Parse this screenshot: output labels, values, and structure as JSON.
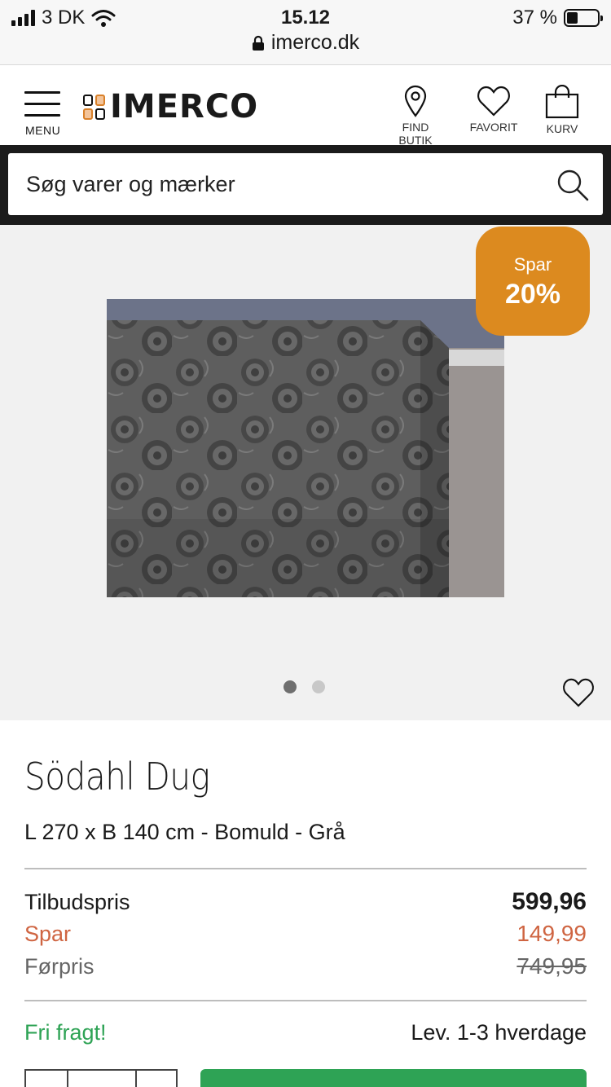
{
  "status_bar": {
    "carrier": "3 DK",
    "time": "15.12",
    "battery": "37 %",
    "battery_level": 0.37,
    "url": "imerco.dk"
  },
  "header": {
    "menu_label": "MENU",
    "logo_text": "IMERCO",
    "find_store_label": "FIND BUTIK",
    "favorite_label": "FAVORIT",
    "cart_label": "KURV"
  },
  "search": {
    "placeholder": "Søg varer og mærker"
  },
  "hero": {
    "badge_line1": "Spar",
    "badge_line2": "20%",
    "badge_color": "#dc8a1f",
    "image_count": 2,
    "active_image": 1
  },
  "product": {
    "title": "Södahl Dug",
    "subtitle": "L 270 x B 140 cm - Bomuld - Grå",
    "offer_label": "Tilbudspris",
    "offer_value": "599,96",
    "save_label": "Spar",
    "save_value": "149,99",
    "before_label": "Førpris",
    "before_value": "749,95",
    "shipping": "Fri fragt!",
    "delivery": "Lev. 1-3 hverdage"
  },
  "colors": {
    "accent_green": "#2ea355",
    "save_red": "#cf6542",
    "search_bg": "#1b1b1b"
  }
}
